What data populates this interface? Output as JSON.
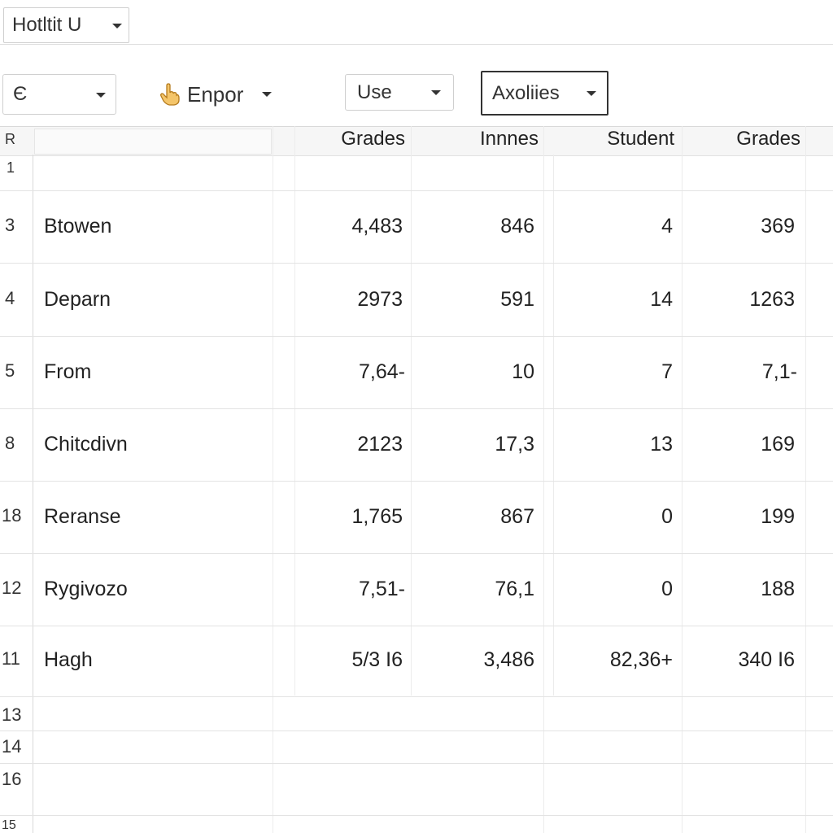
{
  "toolbar": {
    "font_dropdown": {
      "value": "Hotltit U"
    },
    "style_dropdown": {
      "value": "Є"
    },
    "export_menu": {
      "label": "Enpor",
      "icon": "hand-pointer-icon"
    },
    "use_dropdown": {
      "value": "Use"
    },
    "axes_dropdown": {
      "value": "Axolіies"
    }
  },
  "sheet": {
    "corner_label": "R",
    "columns": [
      "Grades",
      "Innnes",
      "Student",
      "Grades"
    ],
    "rows": [
      {
        "num": "1",
        "name": "",
        "values": [
          "",
          "",
          "",
          ""
        ]
      },
      {
        "num": "3",
        "name": "Btowen",
        "values": [
          "4,483",
          "846",
          "4",
          "369"
        ]
      },
      {
        "num": "4",
        "name": "Deparn",
        "values": [
          "2973",
          "591",
          "14",
          "1263"
        ]
      },
      {
        "num": "5",
        "name": "From",
        "values": [
          "7,64-",
          "10",
          "7",
          "7,1-"
        ]
      },
      {
        "num": "8",
        "name": "Chitcdivn",
        "values": [
          "2123",
          "17,3",
          "13",
          "169"
        ]
      },
      {
        "num": "18",
        "name": "Reranse",
        "values": [
          "1,765",
          "867",
          "0",
          "199"
        ]
      },
      {
        "num": "12",
        "name": "Rygivozo",
        "values": [
          "7,51-",
          "76,1",
          "0",
          "188"
        ]
      },
      {
        "num": "11",
        "name": "Hagh",
        "values": [
          "5/3 I6",
          "3,486",
          "82,36+",
          "340 I6"
        ]
      },
      {
        "num": "13",
        "name": "",
        "values": [
          "",
          "",
          "",
          ""
        ]
      },
      {
        "num": "14",
        "name": "",
        "values": [
          "",
          "",
          "",
          ""
        ]
      },
      {
        "num": "16",
        "name": "",
        "values": [
          "",
          "",
          "",
          ""
        ]
      },
      {
        "num": "15",
        "name": "",
        "values": [
          "",
          "",
          "",
          ""
        ]
      }
    ]
  }
}
